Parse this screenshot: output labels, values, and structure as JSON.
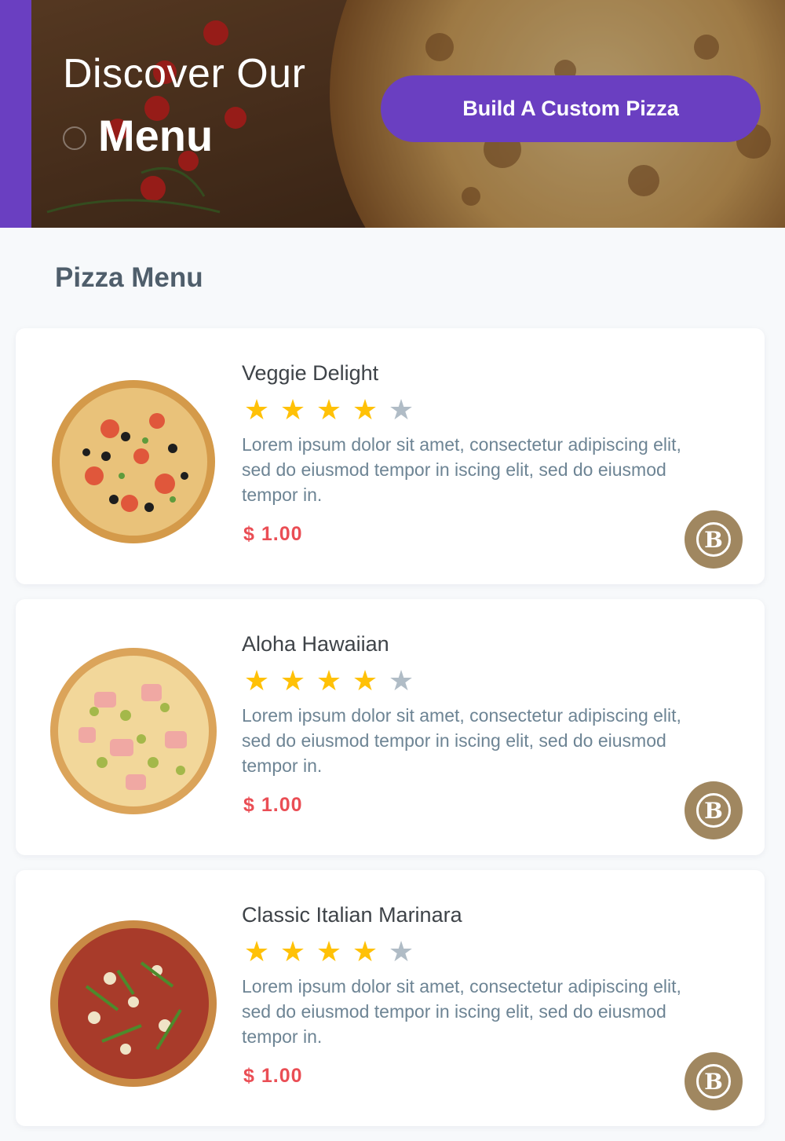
{
  "hero": {
    "title_line1": "Discover Our",
    "title_line2": "Menu",
    "cta_label": "Build A Custom Pizza",
    "accent_color": "#6a3fc1"
  },
  "section": {
    "title": "Pizza Menu"
  },
  "items": [
    {
      "name": "Veggie Delight",
      "rating": 4,
      "max_rating": 5,
      "description": "Lorem ipsum dolor sit amet, consectetur adipiscing elit, sed do eiusmod tempor in iscing elit, sed do eiusmod tempor in.",
      "price": "$ 1.00",
      "badge_letter": "B",
      "image": "veggie-pizza-image"
    },
    {
      "name": "Aloha Hawaiian",
      "rating": 4,
      "max_rating": 5,
      "description": "Lorem ipsum dolor sit amet, consectetur adipiscing elit, sed do eiusmod tempor in iscing elit, sed do eiusmod tempor in.",
      "price": "$ 1.00",
      "badge_letter": "B",
      "image": "hawaiian-pizza-image"
    },
    {
      "name": "Classic Italian Marinara",
      "rating": 4,
      "max_rating": 5,
      "description": "Lorem ipsum dolor sit amet, consectetur adipiscing elit, sed do eiusmod tempor in iscing elit, sed do eiusmod tempor in.",
      "price": "$ 1.00",
      "badge_letter": "B",
      "image": "marinara-pizza-image"
    }
  ],
  "colors": {
    "star_on": "#ffc107",
    "star_off": "#b0bcc6",
    "price": "#ea4e55",
    "badge": "#a08760"
  }
}
